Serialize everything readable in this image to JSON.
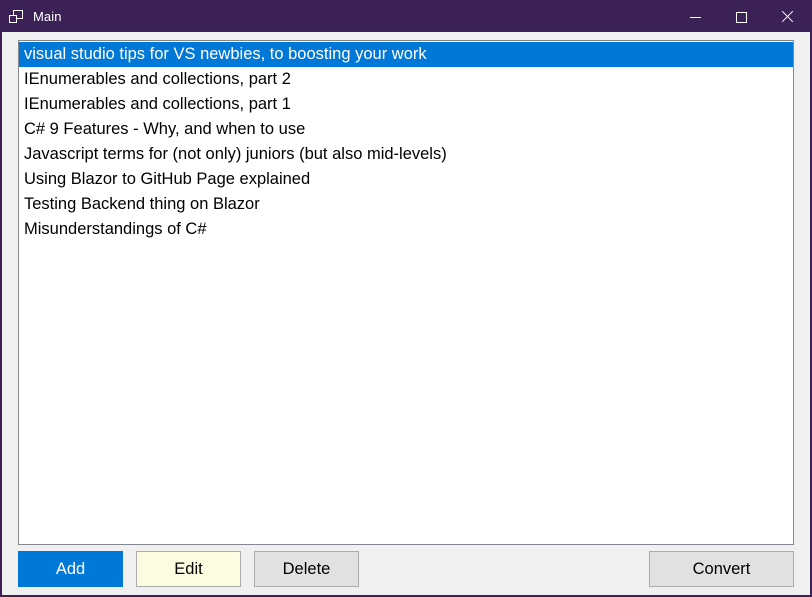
{
  "window": {
    "title": "Main",
    "icon": "app-windows-icon",
    "frame_color": "#3b2155",
    "client_bg": "#f0f0f0",
    "controls": {
      "minimize": "minimize-icon",
      "maximize": "maximize-icon",
      "close": "close-icon"
    }
  },
  "listbox": {
    "background": "#ffffff",
    "border_color": "#828790",
    "selection_color": "#0078d7",
    "selected_index": 0,
    "items": [
      {
        "label": "visual studio tips for VS newbies, to boosting your work",
        "selected": true
      },
      {
        "label": "IEnumerables and collections, part 2",
        "selected": false
      },
      {
        "label": "IEnumerables and collections, part 1",
        "selected": false
      },
      {
        "label": "C# 9 Features - Why, and when to use",
        "selected": false
      },
      {
        "label": "Javascript terms for (not only) juniors (but also mid-levels)",
        "selected": false
      },
      {
        "label": "Using Blazor to GitHub Page explained",
        "selected": false
      },
      {
        "label": "Testing Backend thing on Blazor",
        "selected": false
      },
      {
        "label": "Misunderstandings of C#",
        "selected": false
      }
    ]
  },
  "buttons": {
    "add": {
      "label": "Add",
      "bg": "#0078d7",
      "fg": "#ffffff"
    },
    "edit": {
      "label": "Edit",
      "bg": "#fcfce0",
      "fg": "#000000"
    },
    "delete": {
      "label": "Delete",
      "bg": "#e1e1e1",
      "fg": "#000000"
    },
    "convert": {
      "label": "Convert",
      "bg": "#e1e1e1",
      "fg": "#000000"
    }
  }
}
